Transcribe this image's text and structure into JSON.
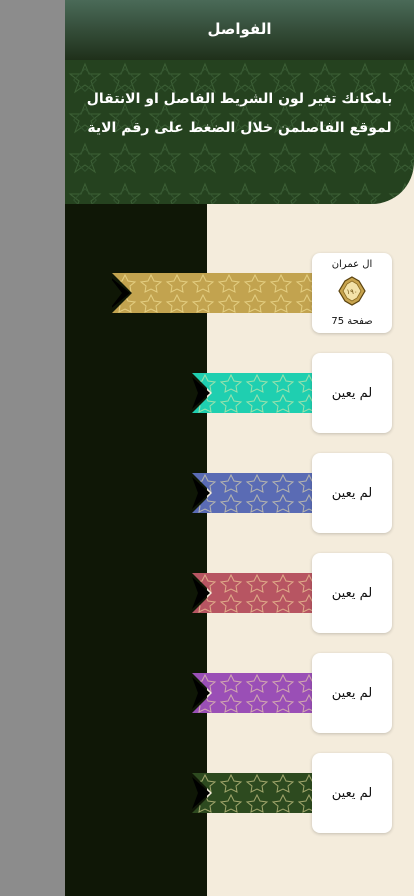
{
  "appbar": {
    "title": "الفواصل"
  },
  "banner": {
    "text": "بامكانك تغير لون الشريط الفاصل او الانتقال لموقع الفاصلمن خلال الضغط على رقم الاية"
  },
  "bookmarks": [
    {
      "color": "#c2a34f",
      "surah": "ال عمران",
      "ayah": "١٩٠",
      "page": "صفحة 75",
      "assigned": true
    },
    {
      "color": "#1fcfb0",
      "label": "لم يعين",
      "assigned": false
    },
    {
      "color": "#5a6bb4",
      "label": "لم يعين",
      "assigned": false
    },
    {
      "color": "#b75562",
      "label": "لم يعين",
      "assigned": false
    },
    {
      "color": "#9a4fb6",
      "label": "لم يعين",
      "assigned": false
    },
    {
      "color": "#2d4a1f",
      "label": "لم يعين",
      "assigned": false
    }
  ]
}
